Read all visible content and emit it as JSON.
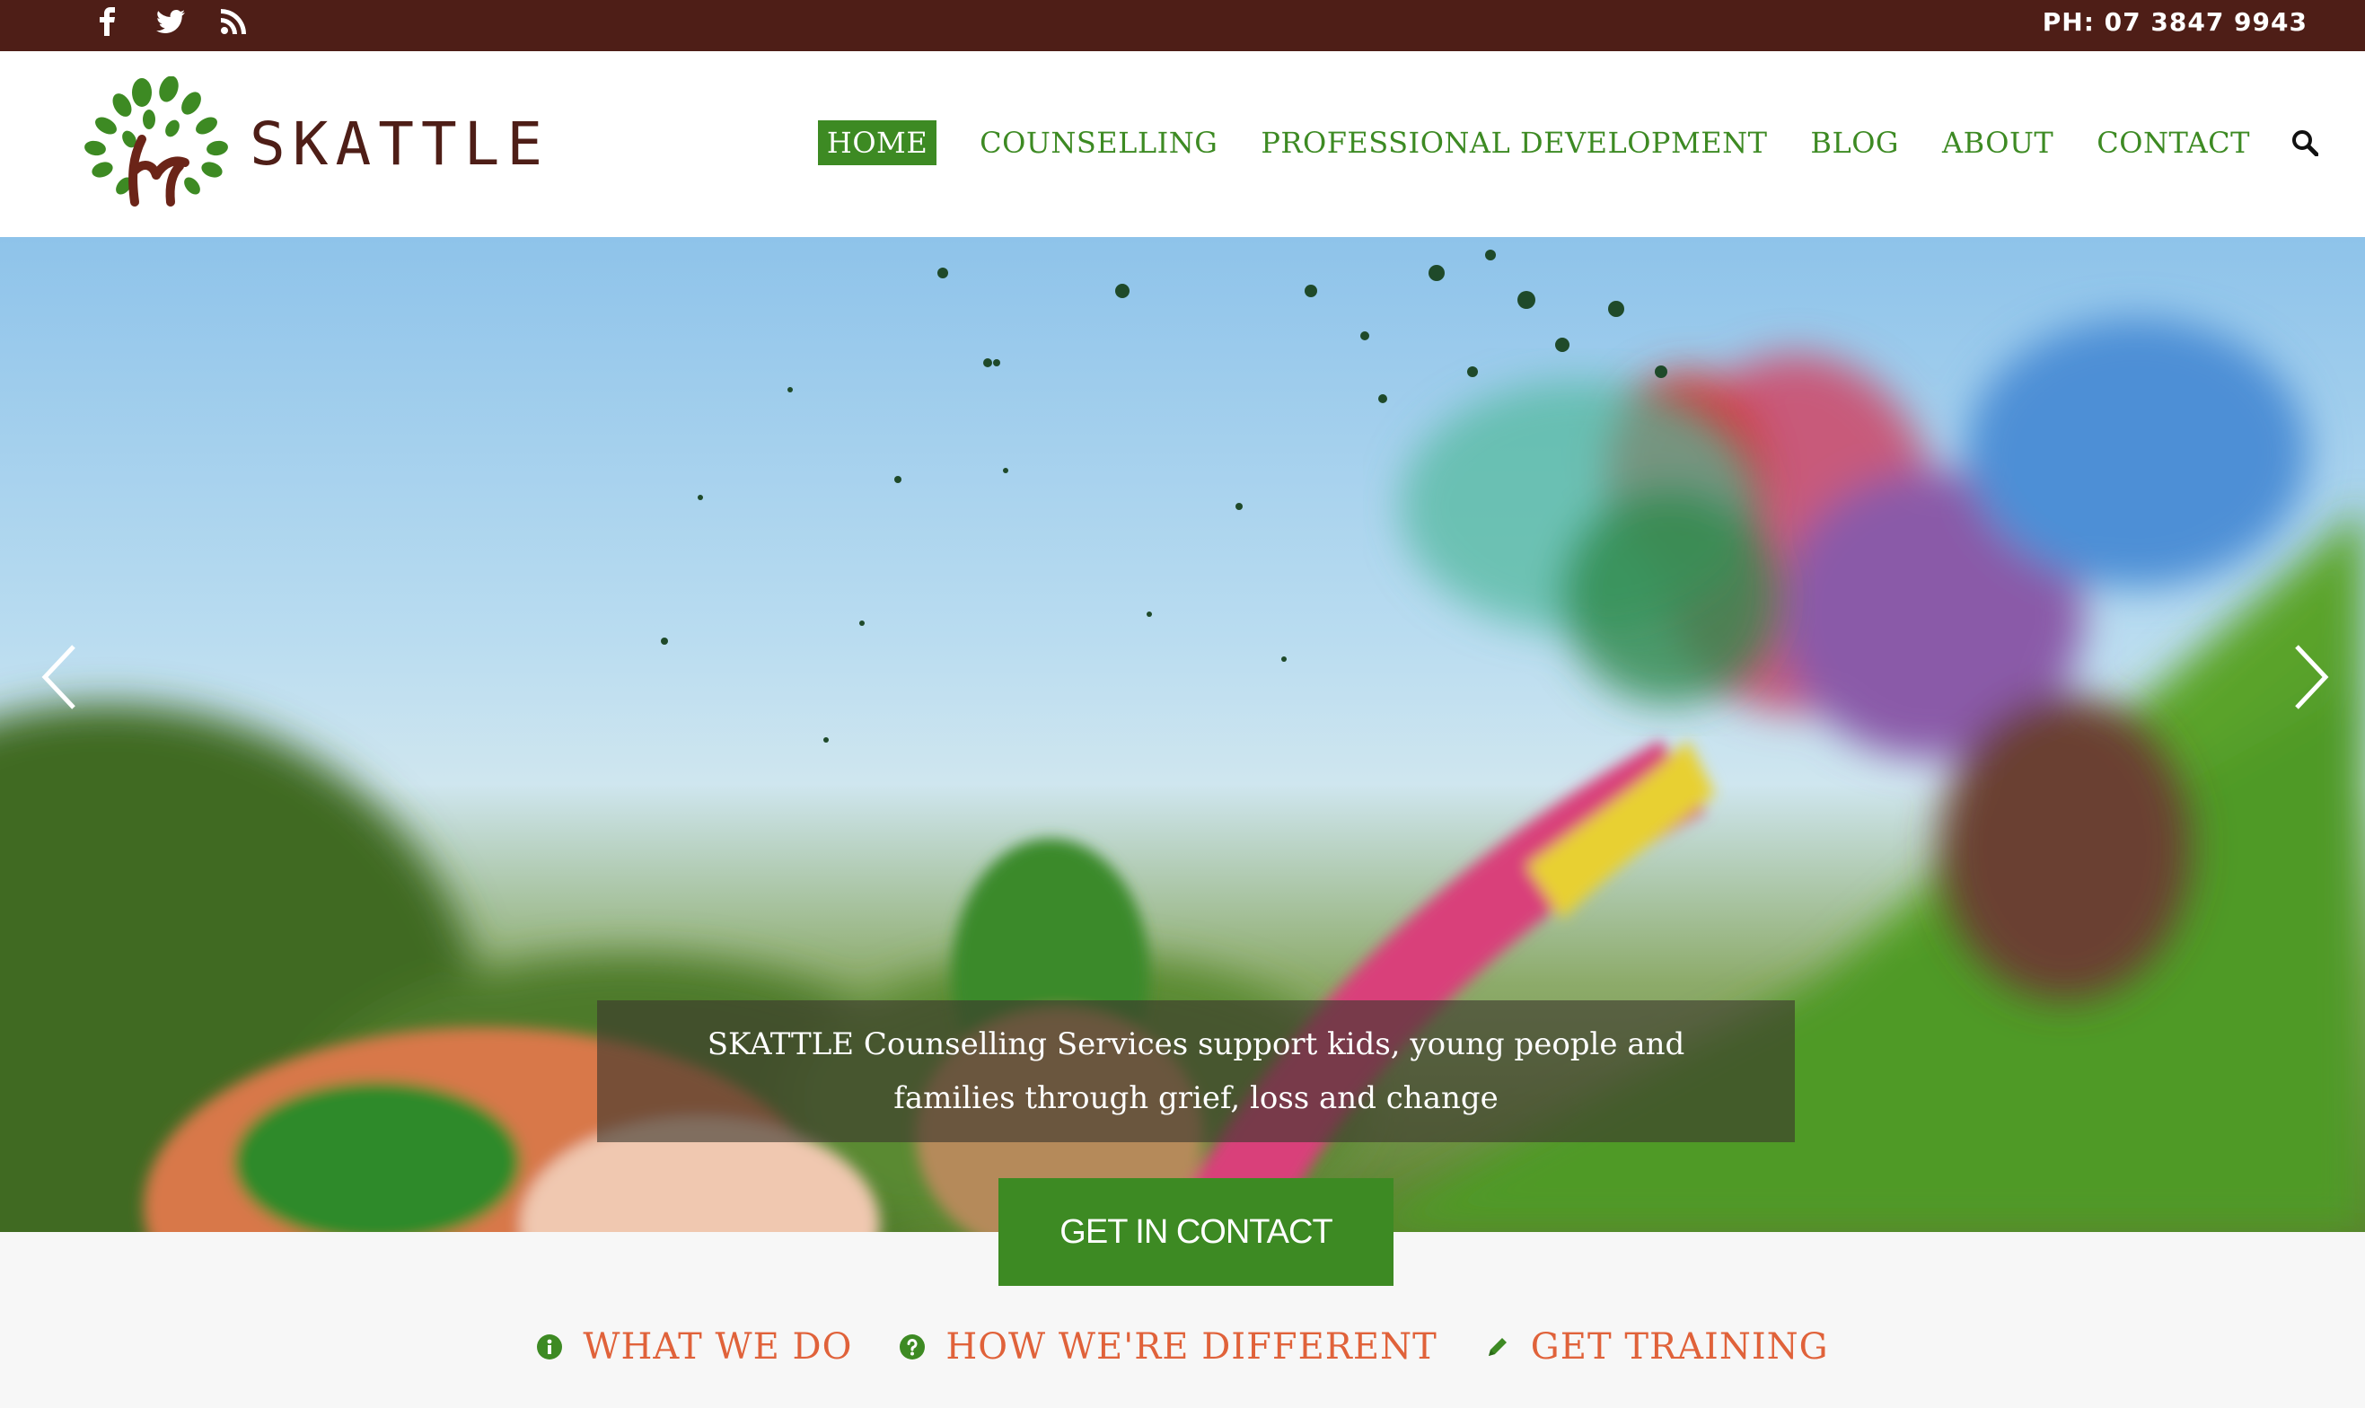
{
  "topbar": {
    "social_icons": [
      "facebook-icon",
      "twitter-icon",
      "rss-icon"
    ],
    "phone": "PH: 07 3847 9943"
  },
  "header": {
    "logo_text": "SKATTLE",
    "nav": [
      {
        "label": "HOME",
        "active": true
      },
      {
        "label": "COUNSELLING",
        "active": false
      },
      {
        "label": "PROFESSIONAL DEVELOPMENT",
        "active": false
      },
      {
        "label": "BLOG",
        "active": false
      },
      {
        "label": "ABOUT",
        "active": false
      },
      {
        "label": "CONTACT",
        "active": false
      }
    ],
    "search_icon": "search-icon"
  },
  "hero": {
    "caption": "SKATTLE Counselling Services support kids, young people and families through grief, loss and change",
    "cta_label": "GET IN CONTACT",
    "prev_icon": "chevron-left-icon",
    "next_icon": "chevron-right-icon"
  },
  "tabs": [
    {
      "label": "WHAT WE DO",
      "icon": "info-icon"
    },
    {
      "label": "HOW WE'RE DIFFERENT",
      "icon": "question-icon"
    },
    {
      "label": "GET TRAINING",
      "icon": "pencil-icon"
    }
  ],
  "colors": {
    "topbar": "#4e1e17",
    "brand_green": "#3d8a23",
    "accent_orange": "#e0623a",
    "logo_brown": "#4e1e17"
  }
}
